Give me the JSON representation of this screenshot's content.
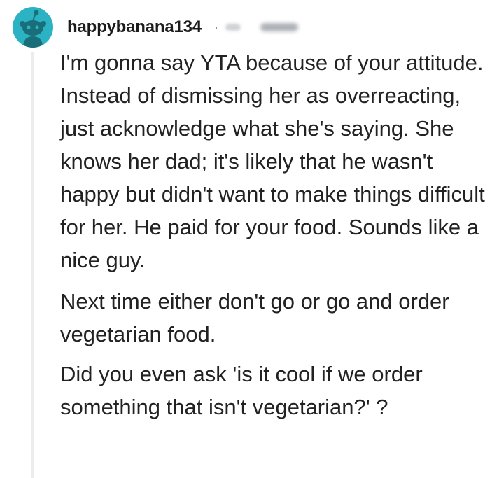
{
  "comment": {
    "username": "happybanana134",
    "separator": "·",
    "paragraphs": [
      "I'm gonna say YTA because of your attitude. Instead of dismissing her as overreacting, just acknowledge what she's saying. She knows her dad; it's likely that he wasn't happy but didn't want to make things difficult for her. He paid for your food. Sounds like a nice guy.",
      "Next time either don't go or go and order vegetarian food.",
      "Did you even ask 'is it cool if we order something that isn't vegetarian?' ?"
    ]
  },
  "icons": {
    "avatar": "snoo-avatar-icon"
  },
  "colors": {
    "avatar_bg": "#2bb3c4",
    "text": "#222222",
    "thread_line": "#ececec"
  }
}
